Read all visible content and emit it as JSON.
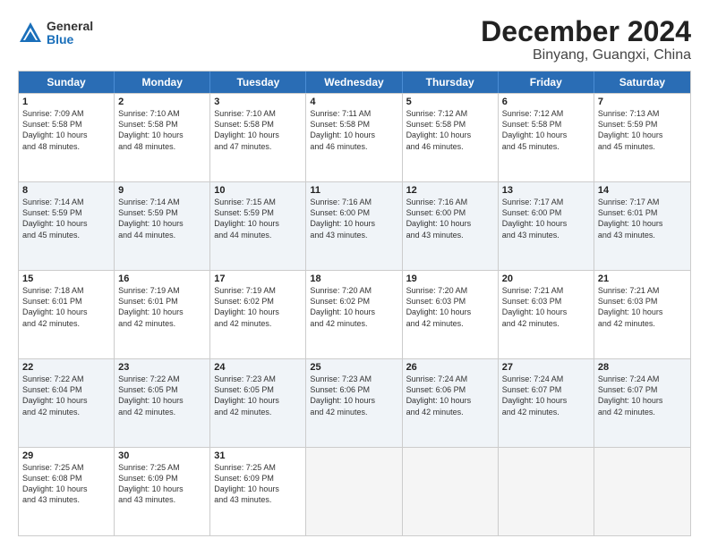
{
  "logo": {
    "general": "General",
    "blue": "Blue"
  },
  "title": "December 2024",
  "subtitle": "Binyang, Guangxi, China",
  "header_days": [
    "Sunday",
    "Monday",
    "Tuesday",
    "Wednesday",
    "Thursday",
    "Friday",
    "Saturday"
  ],
  "rows": [
    [
      {
        "day": "1",
        "lines": [
          "Sunrise: 7:09 AM",
          "Sunset: 5:58 PM",
          "Daylight: 10 hours",
          "and 48 minutes."
        ]
      },
      {
        "day": "2",
        "lines": [
          "Sunrise: 7:10 AM",
          "Sunset: 5:58 PM",
          "Daylight: 10 hours",
          "and 48 minutes."
        ]
      },
      {
        "day": "3",
        "lines": [
          "Sunrise: 7:10 AM",
          "Sunset: 5:58 PM",
          "Daylight: 10 hours",
          "and 47 minutes."
        ]
      },
      {
        "day": "4",
        "lines": [
          "Sunrise: 7:11 AM",
          "Sunset: 5:58 PM",
          "Daylight: 10 hours",
          "and 46 minutes."
        ]
      },
      {
        "day": "5",
        "lines": [
          "Sunrise: 7:12 AM",
          "Sunset: 5:58 PM",
          "Daylight: 10 hours",
          "and 46 minutes."
        ]
      },
      {
        "day": "6",
        "lines": [
          "Sunrise: 7:12 AM",
          "Sunset: 5:58 PM",
          "Daylight: 10 hours",
          "and 45 minutes."
        ]
      },
      {
        "day": "7",
        "lines": [
          "Sunrise: 7:13 AM",
          "Sunset: 5:59 PM",
          "Daylight: 10 hours",
          "and 45 minutes."
        ]
      }
    ],
    [
      {
        "day": "8",
        "lines": [
          "Sunrise: 7:14 AM",
          "Sunset: 5:59 PM",
          "Daylight: 10 hours",
          "and 45 minutes."
        ]
      },
      {
        "day": "9",
        "lines": [
          "Sunrise: 7:14 AM",
          "Sunset: 5:59 PM",
          "Daylight: 10 hours",
          "and 44 minutes."
        ]
      },
      {
        "day": "10",
        "lines": [
          "Sunrise: 7:15 AM",
          "Sunset: 5:59 PM",
          "Daylight: 10 hours",
          "and 44 minutes."
        ]
      },
      {
        "day": "11",
        "lines": [
          "Sunrise: 7:16 AM",
          "Sunset: 6:00 PM",
          "Daylight: 10 hours",
          "and 43 minutes."
        ]
      },
      {
        "day": "12",
        "lines": [
          "Sunrise: 7:16 AM",
          "Sunset: 6:00 PM",
          "Daylight: 10 hours",
          "and 43 minutes."
        ]
      },
      {
        "day": "13",
        "lines": [
          "Sunrise: 7:17 AM",
          "Sunset: 6:00 PM",
          "Daylight: 10 hours",
          "and 43 minutes."
        ]
      },
      {
        "day": "14",
        "lines": [
          "Sunrise: 7:17 AM",
          "Sunset: 6:01 PM",
          "Daylight: 10 hours",
          "and 43 minutes."
        ]
      }
    ],
    [
      {
        "day": "15",
        "lines": [
          "Sunrise: 7:18 AM",
          "Sunset: 6:01 PM",
          "Daylight: 10 hours",
          "and 42 minutes."
        ]
      },
      {
        "day": "16",
        "lines": [
          "Sunrise: 7:19 AM",
          "Sunset: 6:01 PM",
          "Daylight: 10 hours",
          "and 42 minutes."
        ]
      },
      {
        "day": "17",
        "lines": [
          "Sunrise: 7:19 AM",
          "Sunset: 6:02 PM",
          "Daylight: 10 hours",
          "and 42 minutes."
        ]
      },
      {
        "day": "18",
        "lines": [
          "Sunrise: 7:20 AM",
          "Sunset: 6:02 PM",
          "Daylight: 10 hours",
          "and 42 minutes."
        ]
      },
      {
        "day": "19",
        "lines": [
          "Sunrise: 7:20 AM",
          "Sunset: 6:03 PM",
          "Daylight: 10 hours",
          "and 42 minutes."
        ]
      },
      {
        "day": "20",
        "lines": [
          "Sunrise: 7:21 AM",
          "Sunset: 6:03 PM",
          "Daylight: 10 hours",
          "and 42 minutes."
        ]
      },
      {
        "day": "21",
        "lines": [
          "Sunrise: 7:21 AM",
          "Sunset: 6:03 PM",
          "Daylight: 10 hours",
          "and 42 minutes."
        ]
      }
    ],
    [
      {
        "day": "22",
        "lines": [
          "Sunrise: 7:22 AM",
          "Sunset: 6:04 PM",
          "Daylight: 10 hours",
          "and 42 minutes."
        ]
      },
      {
        "day": "23",
        "lines": [
          "Sunrise: 7:22 AM",
          "Sunset: 6:05 PM",
          "Daylight: 10 hours",
          "and 42 minutes."
        ]
      },
      {
        "day": "24",
        "lines": [
          "Sunrise: 7:23 AM",
          "Sunset: 6:05 PM",
          "Daylight: 10 hours",
          "and 42 minutes."
        ]
      },
      {
        "day": "25",
        "lines": [
          "Sunrise: 7:23 AM",
          "Sunset: 6:06 PM",
          "Daylight: 10 hours",
          "and 42 minutes."
        ]
      },
      {
        "day": "26",
        "lines": [
          "Sunrise: 7:24 AM",
          "Sunset: 6:06 PM",
          "Daylight: 10 hours",
          "and 42 minutes."
        ]
      },
      {
        "day": "27",
        "lines": [
          "Sunrise: 7:24 AM",
          "Sunset: 6:07 PM",
          "Daylight: 10 hours",
          "and 42 minutes."
        ]
      },
      {
        "day": "28",
        "lines": [
          "Sunrise: 7:24 AM",
          "Sunset: 6:07 PM",
          "Daylight: 10 hours",
          "and 42 minutes."
        ]
      }
    ],
    [
      {
        "day": "29",
        "lines": [
          "Sunrise: 7:25 AM",
          "Sunset: 6:08 PM",
          "Daylight: 10 hours",
          "and 43 minutes."
        ]
      },
      {
        "day": "30",
        "lines": [
          "Sunrise: 7:25 AM",
          "Sunset: 6:09 PM",
          "Daylight: 10 hours",
          "and 43 minutes."
        ]
      },
      {
        "day": "31",
        "lines": [
          "Sunrise: 7:25 AM",
          "Sunset: 6:09 PM",
          "Daylight: 10 hours",
          "and 43 minutes."
        ]
      },
      {
        "day": "",
        "lines": []
      },
      {
        "day": "",
        "lines": []
      },
      {
        "day": "",
        "lines": []
      },
      {
        "day": "",
        "lines": []
      }
    ]
  ]
}
